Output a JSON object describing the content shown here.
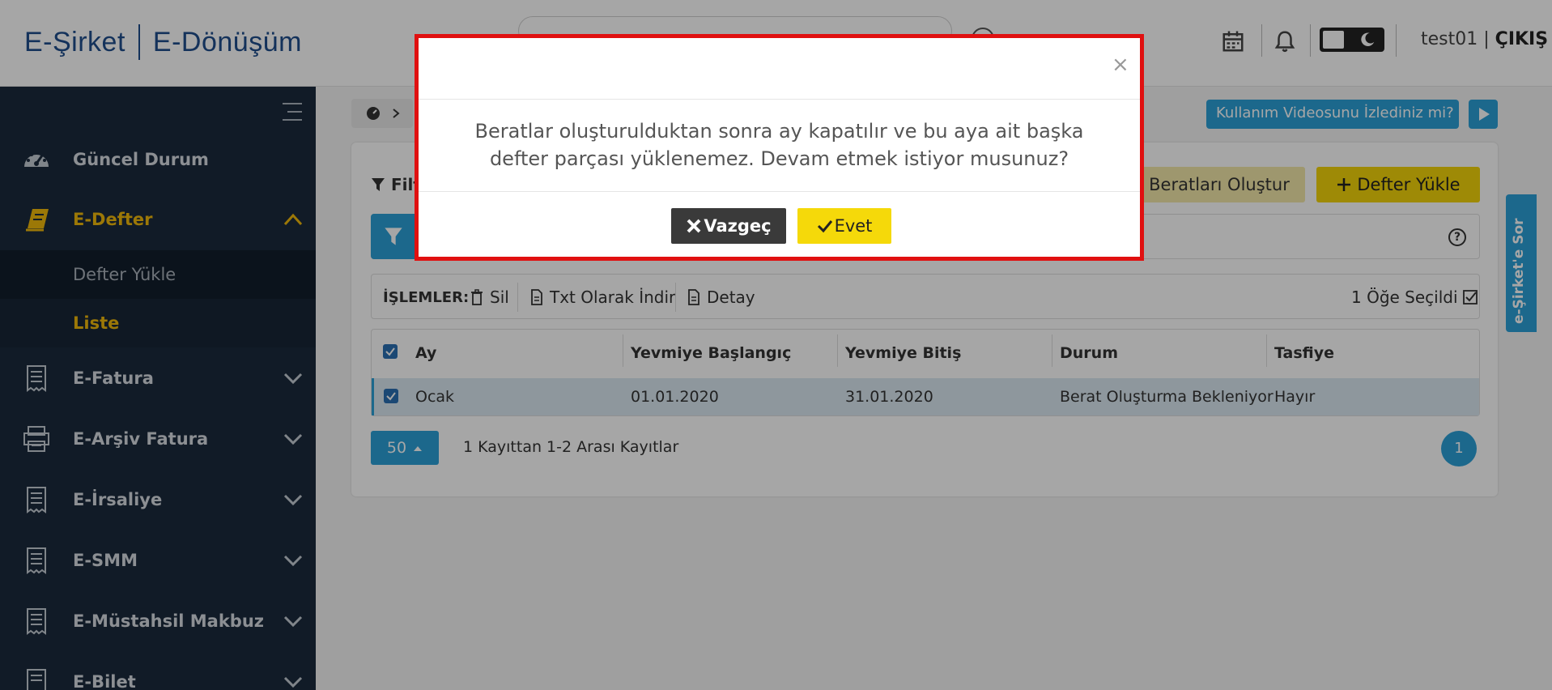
{
  "header": {
    "logo_left": "E-Şirket",
    "logo_right": "E-Dönüşüm",
    "user": "test01",
    "logout": "ÇIKIŞ"
  },
  "sidebar": {
    "items": [
      {
        "label": "Güncel Durum",
        "icon": "dashboard-icon"
      },
      {
        "label": "E-Defter",
        "icon": "book-icon"
      },
      {
        "label": "E-Fatura",
        "icon": "receipt-icon"
      },
      {
        "label": "E-Arşiv Fatura",
        "icon": "archive-icon"
      },
      {
        "label": "E-İrsaliye",
        "icon": "receipt-icon"
      },
      {
        "label": "E-SMM",
        "icon": "receipt-icon"
      },
      {
        "label": "E-Müstahsil Makbuz",
        "icon": "receipt-icon"
      },
      {
        "label": "E-Bilet",
        "icon": "receipt-icon"
      }
    ],
    "sub_items": [
      "Defter Yükle",
      "Liste"
    ]
  },
  "toolbar": {
    "filter_label": "Filt",
    "video_label": "Kullanım Videosunu İzlediniz mi?",
    "berat_label": "Beratları Oluştur",
    "defter_label": "Defter Yükle",
    "help_label": "?",
    "side_tab_label": "e-Şirket'e Sor"
  },
  "operations": {
    "title": "İŞLEMLER:",
    "delete": "Sil",
    "download": "Txt Olarak İndir",
    "detail": "Detay",
    "selected": "1 Öğe Seçildi"
  },
  "table": {
    "headers": [
      "Ay",
      "Yevmiye Başlangıç",
      "Yevmiye Bitiş",
      "Durum",
      "Tasfiye"
    ],
    "rows": [
      [
        "Ocak",
        "01.01.2020",
        "31.01.2020",
        "Berat Oluşturma Bekleniyor",
        "Hayır"
      ]
    ]
  },
  "pager": {
    "page_size": "50",
    "records": "1 Kayıttan 1-2 Arası Kayıtlar",
    "current_page": "1"
  },
  "modal": {
    "close": "×",
    "message": "Beratlar oluşturulduktan sonra ay kapatılır ve bu aya ait başka defter parçası yüklenemez. Devam etmek istiyor musunuz?",
    "cancel": "Vazgeç",
    "confirm": "Evet"
  }
}
